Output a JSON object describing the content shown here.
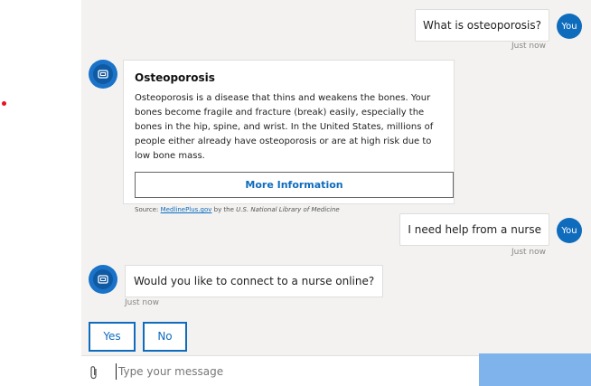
{
  "colors": {
    "accent": "#0f6cbd",
    "chat_bg": "#f3f2f1",
    "send_area": "#7fb3eb"
  },
  "messages": {
    "user1": {
      "text": "What is osteoporosis?",
      "avatar": "You",
      "time": "Just now"
    },
    "user2": {
      "text": "I need help from a nurse",
      "avatar": "You",
      "time": "Just now"
    },
    "bot2": {
      "text": "Would you like to connect to a nurse online?",
      "time": "Just now"
    }
  },
  "card": {
    "title": "Osteoporosis",
    "body": "Osteoporosis is a disease that thins and weakens the bones. Your bones become fragile and fracture (break) easily, especially the bones in the hip, spine, and wrist. In the United States, millions of people either already have osteoporosis or are at high risk due to low bone mass.",
    "button": "More Information",
    "source_prefix": "Source: ",
    "source_link": "MedlinePlus.gov",
    "source_by": " by the ",
    "source_org": "U.S. National Library of Medicine"
  },
  "options": {
    "yes": "Yes",
    "no": "No"
  },
  "input": {
    "placeholder": "Type your message"
  },
  "icons": {
    "attach": "paperclip-icon",
    "bot": "bot-avatar-icon"
  }
}
